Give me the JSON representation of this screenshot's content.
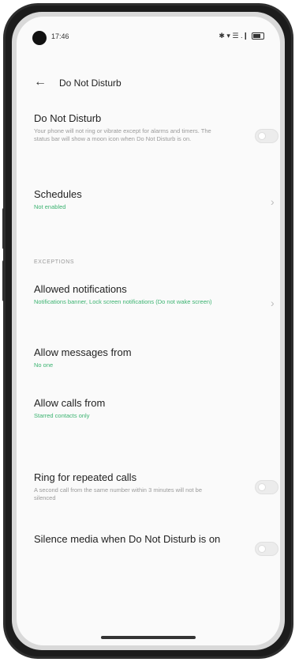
{
  "status_bar": {
    "time": "17:46",
    "icons": "✱ ▾ ☰ .❙"
  },
  "header": {
    "back_icon": "arrow-left",
    "title": "Do Not Disturb"
  },
  "dnd": {
    "title": "Do Not Disturb",
    "description": "Your phone will not ring or vibrate except for alarms and timers. The status bar will show a moon icon when Do Not Disturb is on.",
    "enabled": false
  },
  "schedules": {
    "title": "Schedules",
    "subtitle": "Not enabled"
  },
  "section_label": "EXCEPTIONS",
  "allowed_notifications": {
    "title": "Allowed notifications",
    "subtitle": "Notifications banner, Lock screen notifications (Do not wake screen)"
  },
  "allow_messages": {
    "title": "Allow messages from",
    "subtitle": "No one"
  },
  "allow_calls": {
    "title": "Allow calls from",
    "subtitle": "Starred contacts only"
  },
  "repeated_calls": {
    "title": "Ring for repeated calls",
    "description": "A second call from the same number within 3 minutes will not be silenced",
    "enabled": false
  },
  "silence_media": {
    "title": "Silence media when Do Not Disturb is on",
    "enabled": false
  },
  "colors": {
    "accent": "#3cb371",
    "background": "#fafafa",
    "text": "#222222"
  }
}
